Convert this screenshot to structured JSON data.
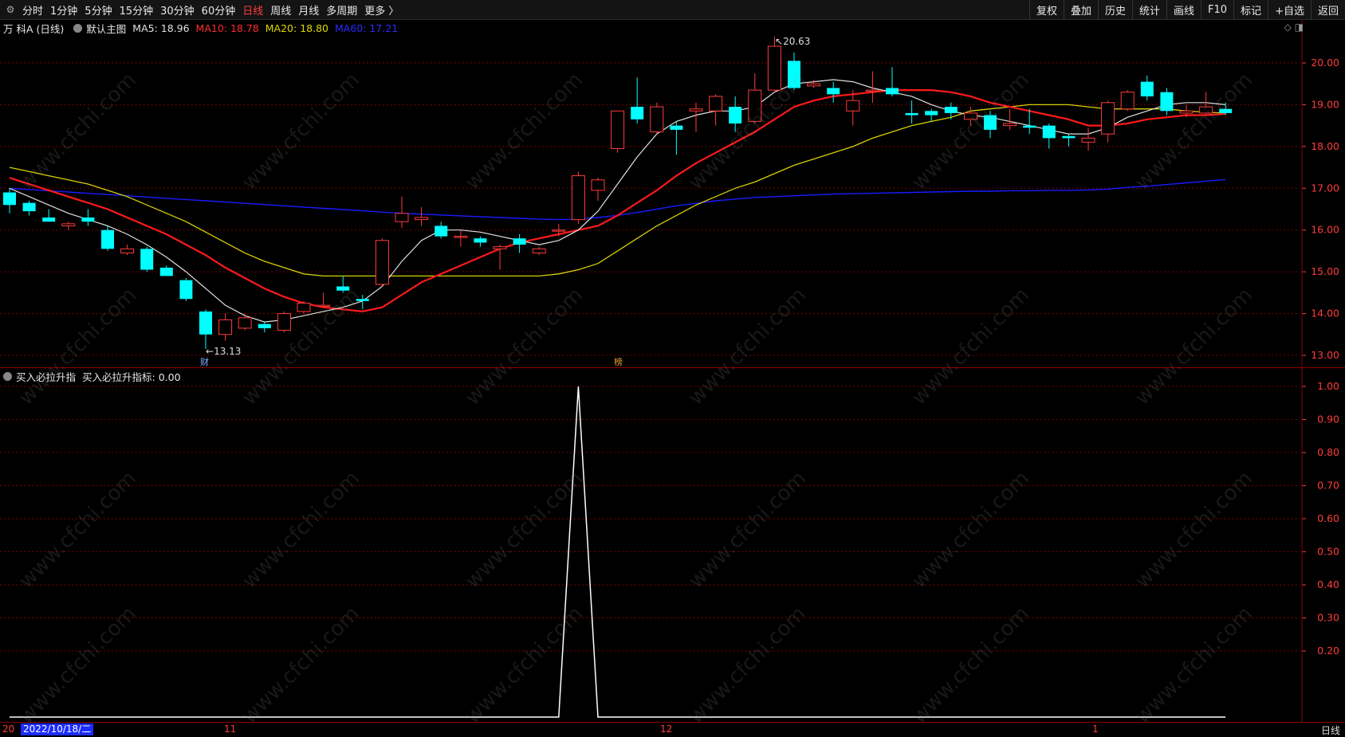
{
  "toolbar": {
    "periods": [
      "分时",
      "1分钟",
      "5分钟",
      "15分钟",
      "30分钟",
      "60分钟",
      "日线",
      "周线",
      "月线",
      "多周期",
      "更多 〉"
    ],
    "active_period": "日线",
    "right_buttons": [
      "复权",
      "叠加",
      "历史",
      "统计",
      "画线",
      "F10",
      "标记",
      "+自选",
      "返回"
    ]
  },
  "main": {
    "stock_title": "万 科A (日线)",
    "template": "默认主图",
    "ma5_label": "MA5: 18.96",
    "ma10_label": "MA10: 18.78",
    "ma20_label": "MA20: 18.80",
    "ma60_label": "MA60: 17.21",
    "corner_icons": "◇ ◨",
    "high_label": "20.63",
    "low_label": "13.13",
    "finance_mark": "财",
    "list_mark": "榜",
    "y_ticks": [
      "20.00",
      "19.00",
      "18.00",
      "17.00",
      "16.00",
      "15.00",
      "14.00",
      "13.00"
    ]
  },
  "indicator": {
    "name": "买入必拉升指",
    "value_label": "买入必拉升指标: 0.00",
    "y_ticks": [
      "1.00",
      "0.90",
      "0.80",
      "0.70",
      "0.60",
      "0.50",
      "0.40",
      "0.30",
      "0.20"
    ]
  },
  "x_axis": {
    "cursor_date": "2022/10/18/二",
    "month_labels": [
      "20",
      "11",
      "12",
      "1"
    ],
    "period": "日线"
  },
  "colors": {
    "up": "#ff3b3b",
    "down": "#00ffff",
    "ma5": "#e0e0e0",
    "ma10": "#ff1a1a",
    "ma20": "#d8d000",
    "ma60": "#1a1aff",
    "grid": "#7a0000"
  },
  "watermark": "www.cfchi.com",
  "chart_data": [
    {
      "type": "candlestick",
      "ylim": [
        12.9,
        20.55
      ],
      "candles": [
        {
          "o": 16.9,
          "h": 17.0,
          "l": 16.4,
          "c": 16.6
        },
        {
          "o": 16.65,
          "h": 16.7,
          "l": 16.35,
          "c": 16.45
        },
        {
          "o": 16.3,
          "h": 16.5,
          "l": 16.2,
          "c": 16.2
        },
        {
          "o": 16.1,
          "h": 16.2,
          "l": 16.0,
          "c": 16.15
        },
        {
          "o": 16.3,
          "h": 16.5,
          "l": 16.1,
          "c": 16.2
        },
        {
          "o": 16.0,
          "h": 16.1,
          "l": 15.5,
          "c": 15.55
        },
        {
          "o": 15.45,
          "h": 15.65,
          "l": 15.4,
          "c": 15.55
        },
        {
          "o": 15.55,
          "h": 15.6,
          "l": 15.0,
          "c": 15.05
        },
        {
          "o": 15.1,
          "h": 15.15,
          "l": 14.9,
          "c": 14.9
        },
        {
          "o": 14.8,
          "h": 14.85,
          "l": 14.3,
          "c": 14.35
        },
        {
          "o": 14.05,
          "h": 14.1,
          "l": 13.15,
          "c": 13.5
        },
        {
          "o": 13.5,
          "h": 14.0,
          "l": 13.35,
          "c": 13.85
        },
        {
          "o": 13.65,
          "h": 14.0,
          "l": 13.6,
          "c": 13.9
        },
        {
          "o": 13.75,
          "h": 13.8,
          "l": 13.55,
          "c": 13.65
        },
        {
          "o": 13.6,
          "h": 14.05,
          "l": 13.55,
          "c": 14.0
        },
        {
          "o": 14.05,
          "h": 14.3,
          "l": 14.0,
          "c": 14.25
        },
        {
          "o": 14.2,
          "h": 14.5,
          "l": 14.15,
          "c": 14.2
        },
        {
          "o": 14.65,
          "h": 14.9,
          "l": 14.5,
          "c": 14.55
        },
        {
          "o": 14.35,
          "h": 14.45,
          "l": 14.1,
          "c": 14.3
        },
        {
          "o": 14.7,
          "h": 15.8,
          "l": 14.65,
          "c": 15.75
        },
        {
          "o": 16.2,
          "h": 16.8,
          "l": 16.05,
          "c": 16.4
        },
        {
          "o": 16.25,
          "h": 16.55,
          "l": 16.1,
          "c": 16.3
        },
        {
          "o": 16.1,
          "h": 16.2,
          "l": 15.8,
          "c": 15.85
        },
        {
          "o": 15.85,
          "h": 16.0,
          "l": 15.6,
          "c": 15.85
        },
        {
          "o": 15.8,
          "h": 15.85,
          "l": 15.6,
          "c": 15.7
        },
        {
          "o": 15.55,
          "h": 15.65,
          "l": 15.05,
          "c": 15.6
        },
        {
          "o": 15.8,
          "h": 15.9,
          "l": 15.45,
          "c": 15.65
        },
        {
          "o": 15.45,
          "h": 15.6,
          "l": 15.4,
          "c": 15.55
        },
        {
          "o": 16.0,
          "h": 16.15,
          "l": 15.85,
          "c": 16.0
        },
        {
          "o": 16.25,
          "h": 17.4,
          "l": 16.15,
          "c": 17.3
        },
        {
          "o": 16.95,
          "h": 17.25,
          "l": 16.7,
          "c": 17.2
        },
        {
          "o": 17.95,
          "h": 18.85,
          "l": 17.85,
          "c": 18.85
        },
        {
          "o": 18.95,
          "h": 19.65,
          "l": 18.55,
          "c": 18.65
        },
        {
          "o": 18.35,
          "h": 19.05,
          "l": 18.3,
          "c": 18.95
        },
        {
          "o": 18.5,
          "h": 18.6,
          "l": 17.8,
          "c": 18.4
        },
        {
          "o": 18.85,
          "h": 19.05,
          "l": 18.35,
          "c": 18.9
        },
        {
          "o": 18.85,
          "h": 19.25,
          "l": 18.5,
          "c": 19.2
        },
        {
          "o": 18.95,
          "h": 19.2,
          "l": 18.35,
          "c": 18.55
        },
        {
          "o": 18.6,
          "h": 19.75,
          "l": 18.55,
          "c": 19.35
        },
        {
          "o": 19.35,
          "h": 20.63,
          "l": 19.3,
          "c": 20.4
        },
        {
          "o": 20.05,
          "h": 20.25,
          "l": 19.35,
          "c": 19.4
        },
        {
          "o": 19.45,
          "h": 19.6,
          "l": 19.4,
          "c": 19.5
        },
        {
          "o": 19.4,
          "h": 19.55,
          "l": 19.05,
          "c": 19.25
        },
        {
          "o": 18.85,
          "h": 19.35,
          "l": 18.5,
          "c": 19.1
        },
        {
          "o": 19.35,
          "h": 19.8,
          "l": 19.05,
          "c": 19.35
        },
        {
          "o": 19.4,
          "h": 19.9,
          "l": 19.2,
          "c": 19.25
        },
        {
          "o": 18.8,
          "h": 19.1,
          "l": 18.55,
          "c": 18.75
        },
        {
          "o": 18.85,
          "h": 18.9,
          "l": 18.6,
          "c": 18.75
        },
        {
          "o": 18.95,
          "h": 19.05,
          "l": 18.65,
          "c": 18.8
        },
        {
          "o": 18.65,
          "h": 18.95,
          "l": 18.5,
          "c": 18.8
        },
        {
          "o": 18.75,
          "h": 18.85,
          "l": 18.2,
          "c": 18.4
        },
        {
          "o": 18.5,
          "h": 18.9,
          "l": 18.4,
          "c": 18.55
        },
        {
          "o": 18.5,
          "h": 18.9,
          "l": 18.3,
          "c": 18.45
        },
        {
          "o": 18.5,
          "h": 18.55,
          "l": 17.95,
          "c": 18.2
        },
        {
          "o": 18.25,
          "h": 18.3,
          "l": 18.0,
          "c": 18.2
        },
        {
          "o": 18.1,
          "h": 18.45,
          "l": 17.9,
          "c": 18.2
        },
        {
          "o": 18.3,
          "h": 19.1,
          "l": 18.1,
          "c": 19.05
        },
        {
          "o": 18.9,
          "h": 19.35,
          "l": 18.85,
          "c": 19.3
        },
        {
          "o": 19.55,
          "h": 19.7,
          "l": 19.1,
          "c": 19.2
        },
        {
          "o": 19.3,
          "h": 19.4,
          "l": 18.75,
          "c": 18.85
        },
        {
          "o": 18.8,
          "h": 19.0,
          "l": 18.7,
          "c": 18.85
        },
        {
          "o": 18.8,
          "h": 19.3,
          "l": 18.75,
          "c": 18.95
        },
        {
          "o": 18.9,
          "h": 19.05,
          "l": 18.75,
          "c": 18.8
        }
      ],
      "ma5": [
        17.0,
        16.8,
        16.6,
        16.4,
        16.25,
        16.1,
        15.9,
        15.65,
        15.35,
        15.0,
        14.6,
        14.2,
        13.95,
        13.8,
        13.85,
        13.95,
        14.05,
        14.15,
        14.3,
        14.65,
        15.25,
        15.75,
        16.0,
        16.0,
        15.95,
        15.85,
        15.75,
        15.65,
        15.75,
        16.0,
        16.45,
        17.1,
        17.75,
        18.3,
        18.6,
        18.75,
        18.85,
        18.85,
        18.95,
        19.3,
        19.5,
        19.55,
        19.6,
        19.55,
        19.4,
        19.3,
        19.2,
        19.0,
        18.85,
        18.75,
        18.7,
        18.6,
        18.5,
        18.4,
        18.3,
        18.3,
        18.45,
        18.7,
        18.85,
        19.0,
        19.05,
        19.05,
        19.0
      ],
      "ma10": [
        17.25,
        17.1,
        16.95,
        16.8,
        16.65,
        16.5,
        16.3,
        16.1,
        15.9,
        15.65,
        15.4,
        15.1,
        14.85,
        14.6,
        14.4,
        14.25,
        14.15,
        14.1,
        14.05,
        14.15,
        14.45,
        14.75,
        14.95,
        15.15,
        15.35,
        15.55,
        15.7,
        15.8,
        15.9,
        16.0,
        16.1,
        16.35,
        16.65,
        16.95,
        17.3,
        17.6,
        17.85,
        18.1,
        18.35,
        18.65,
        18.95,
        19.1,
        19.2,
        19.25,
        19.3,
        19.35,
        19.35,
        19.35,
        19.3,
        19.2,
        19.05,
        18.95,
        18.85,
        18.75,
        18.65,
        18.5,
        18.5,
        18.55,
        18.65,
        18.7,
        18.75,
        18.75,
        18.78
      ],
      "ma20": [
        17.5,
        17.4,
        17.3,
        17.2,
        17.1,
        16.95,
        16.8,
        16.6,
        16.4,
        16.2,
        15.95,
        15.7,
        15.45,
        15.25,
        15.1,
        14.95,
        14.9,
        14.9,
        14.9,
        14.9,
        14.9,
        14.9,
        14.9,
        14.9,
        14.9,
        14.9,
        14.9,
        14.9,
        14.95,
        15.05,
        15.2,
        15.5,
        15.8,
        16.1,
        16.35,
        16.6,
        16.8,
        17.0,
        17.15,
        17.35,
        17.55,
        17.7,
        17.85,
        18.0,
        18.2,
        18.35,
        18.5,
        18.6,
        18.7,
        18.85,
        18.9,
        18.95,
        19.0,
        19.0,
        19.0,
        18.95,
        18.9,
        18.9,
        18.9,
        18.9,
        18.85,
        18.82,
        18.8
      ],
      "ma60": [
        17.0,
        16.97,
        16.94,
        16.91,
        16.88,
        16.85,
        16.82,
        16.79,
        16.76,
        16.73,
        16.7,
        16.67,
        16.64,
        16.61,
        16.58,
        16.55,
        16.52,
        16.49,
        16.46,
        16.43,
        16.4,
        16.38,
        16.36,
        16.34,
        16.32,
        16.3,
        16.28,
        16.26,
        16.25,
        16.26,
        16.3,
        16.35,
        16.42,
        16.5,
        16.58,
        16.64,
        16.7,
        16.74,
        16.78,
        16.8,
        16.82,
        16.84,
        16.86,
        16.87,
        16.88,
        16.89,
        16.9,
        16.91,
        16.92,
        16.93,
        16.93,
        16.94,
        16.94,
        16.95,
        16.95,
        16.96,
        16.98,
        17.02,
        17.05,
        17.09,
        17.13,
        17.17,
        17.21
      ]
    },
    {
      "type": "line",
      "name": "买入必拉升指标",
      "ylim": [
        0,
        1.0
      ],
      "values": [
        0,
        0,
        0,
        0,
        0,
        0,
        0,
        0,
        0,
        0,
        0,
        0,
        0,
        0,
        0,
        0,
        0,
        0,
        0,
        0,
        0,
        0,
        0,
        0,
        0,
        0,
        0,
        0,
        0,
        1,
        0,
        0,
        0,
        0,
        0,
        0,
        0,
        0,
        0,
        0,
        0,
        0,
        0,
        0,
        0,
        0,
        0,
        0,
        0,
        0,
        0,
        0,
        0,
        0,
        0,
        0,
        0,
        0,
        0,
        0,
        0,
        0,
        0
      ]
    }
  ]
}
